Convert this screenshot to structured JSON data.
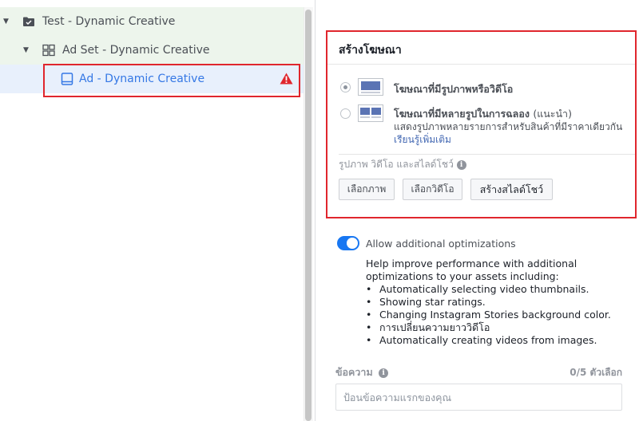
{
  "tree": {
    "campaign_label": "Test - Dynamic Creative",
    "adset_label": "Ad Set - Dynamic Creative",
    "ad_label": "Ad - Dynamic Creative",
    "icons": {
      "campaign": "folder-icon",
      "adset": "grid-icon",
      "ad": "tablet-icon",
      "warning": "warning-triangle-icon"
    }
  },
  "create_ad": {
    "title": "สร้างโฆษณา",
    "option_single_title": "โฆษณาที่มีรูปภาพหรือวิดีโอ",
    "option_multi_title": "โฆษณาที่มีหลายรูปในการฉลอง",
    "option_multi_recommended": "(แนะนำ)",
    "option_multi_desc": "แสดงรูปภาพหลายรายการสำหรับสินค้าที่มีราคาเดียวกัน",
    "learn_more": "เรียนรู้เพิ่มเติม",
    "media_label": "รูปภาพ วิดีโอ และสไลด์โชว์",
    "btn_image": "เลือกภาพ",
    "btn_video": "เลือกวิดีโอ",
    "btn_slideshow": "สร้างสไลด์โชว์",
    "selected_option": "single"
  },
  "optimizations": {
    "toggle_label": "Allow additional optimizations",
    "toggle_on": true,
    "help_intro": "Help improve performance with additional optimizations to your assets including:",
    "items": [
      "Automatically selecting video thumbnails.",
      "Showing star ratings.",
      "Changing Instagram Stories background color.",
      "การเปลี่ยนความยาววิดีโอ",
      "Automatically creating videos from images."
    ]
  },
  "primary_text": {
    "label": "ข้อความ",
    "counter": "0/5 ตัวเลือก",
    "placeholder": "ป้อนข้อความแรกของคุณ",
    "value": ""
  },
  "colors": {
    "highlight_red": "#e0262d",
    "link_blue": "#3578e5",
    "toggle_blue": "#1877f2",
    "tree_green_bg": "#edf5ec",
    "tree_selected_bg": "#e8f0fc"
  }
}
